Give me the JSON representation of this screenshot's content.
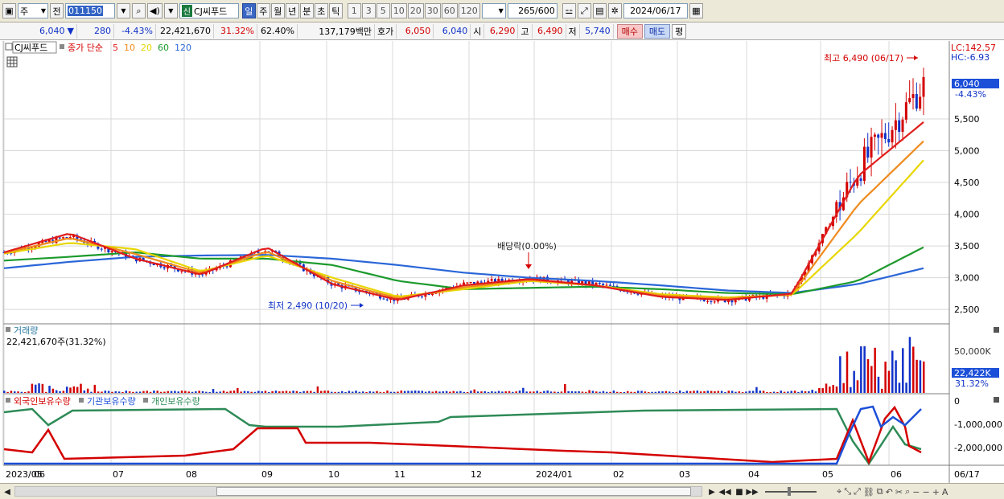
{
  "toolbar": {
    "period_type": "주",
    "prev_label": "전",
    "stock_code": "011150",
    "new_badge": "신",
    "stock_name": "CJ씨푸드",
    "tabs": [
      "일",
      "주",
      "월",
      "년",
      "분",
      "초",
      "틱"
    ],
    "active_tab": "일",
    "intervals": [
      "1",
      "3",
      "5",
      "10",
      "20",
      "30",
      "60",
      "120"
    ],
    "count": "265/600",
    "date": "2024/06/17"
  },
  "quote": {
    "price": "6,040",
    "change": "280",
    "change_pct": "-4.43%",
    "volume": "22,421,670",
    "volume_pct": "31.32%",
    "turnover_pct": "62.40%",
    "amount": "137,179백만",
    "bid_label": "호가",
    "bid1": "6,050",
    "bid2": "6,040",
    "open_label": "시",
    "open": "6,290",
    "high_label": "고",
    "high": "6,490",
    "low_label": "저",
    "low": "5,740",
    "buy_label": "매수",
    "sell_label": "매도",
    "misc_label": "평"
  },
  "legend": {
    "name": "CJ씨푸드",
    "series_label": "종가 단순",
    "ma": [
      {
        "period": "5",
        "color": "#e01c1c"
      },
      {
        "period": "10",
        "color": "#f08a1c"
      },
      {
        "period": "20",
        "color": "#e8d600"
      },
      {
        "period": "60",
        "color": "#1c9a2c"
      },
      {
        "period": "120",
        "color": "#2a66d8"
      }
    ]
  },
  "price_panel": {
    "lc_label": "LC:142.57",
    "hc_label": "HC:-6.93",
    "high_note": "최고 6,490 (06/17)",
    "low_note": "최저 2,490 (10/20)",
    "dividend_note": "배당락(0.00%)",
    "current_price_tag": "6,040",
    "current_change_tag": "-4.43%",
    "y_ticks": [
      "5,500",
      "5,000",
      "4,500",
      "4,000",
      "3,500",
      "3,000",
      "2,500"
    ]
  },
  "volume_panel": {
    "title": "거래량",
    "value_line": "22,421,670주(31.32%)",
    "y_tick": "50,000K",
    "current_tag": "22,422K",
    "current_pct": "31.32%"
  },
  "holdings_panel": {
    "series": [
      {
        "name": "외국인보유수량",
        "color": "#d40000"
      },
      {
        "name": "기관보유수량",
        "color": "#1c4fd8"
      },
      {
        "name": "개인보유수량",
        "color": "#2e8b57"
      }
    ],
    "y_ticks": [
      "0",
      "-1,000,000",
      "-2,000,000"
    ]
  },
  "x_axis": {
    "labels": [
      "2023/05",
      "06",
      "07",
      "08",
      "09",
      "10",
      "11",
      "12",
      "2024/01",
      "02",
      "03",
      "04",
      "05",
      "06"
    ],
    "right_label": "06/17"
  },
  "colors": {
    "up": "#d40000",
    "down": "#1032c8",
    "grid": "#d8d8d8"
  },
  "chart_data": {
    "type": "line",
    "title": "",
    "xlabel": "",
    "ylabel": "",
    "ylim": [
      2300,
      6600
    ],
    "x": [
      "2023/05",
      "06",
      "07",
      "08",
      "09",
      "10",
      "11",
      "12",
      "2024/01",
      "02",
      "03",
      "04",
      "05",
      "06",
      "06/17"
    ],
    "series": [
      {
        "name": "종가",
        "values": [
          3400,
          3650,
          3300,
          3050,
          3450,
          2900,
          2650,
          2900,
          2990,
          2900,
          2700,
          2650,
          2750,
          4700,
          6040
        ]
      },
      {
        "name": "5",
        "values": [
          3400,
          3700,
          3300,
          3050,
          3480,
          2900,
          2650,
          2880,
          2980,
          2880,
          2700,
          2650,
          2750,
          4600,
          5450
        ]
      },
      {
        "name": "20",
        "values": [
          3380,
          3550,
          3450,
          3100,
          3350,
          3000,
          2700,
          2820,
          2950,
          2880,
          2740,
          2690,
          2730,
          3700,
          4850
        ]
      },
      {
        "name": "60",
        "values": [
          3270,
          3330,
          3400,
          3300,
          3300,
          3200,
          2950,
          2820,
          2840,
          2860,
          2820,
          2760,
          2740,
          2950,
          3480
        ]
      },
      {
        "name": "120",
        "values": [
          3150,
          3250,
          3330,
          3350,
          3360,
          3300,
          3200,
          3080,
          3000,
          2950,
          2880,
          2800,
          2760,
          2900,
          3150
        ]
      }
    ]
  }
}
